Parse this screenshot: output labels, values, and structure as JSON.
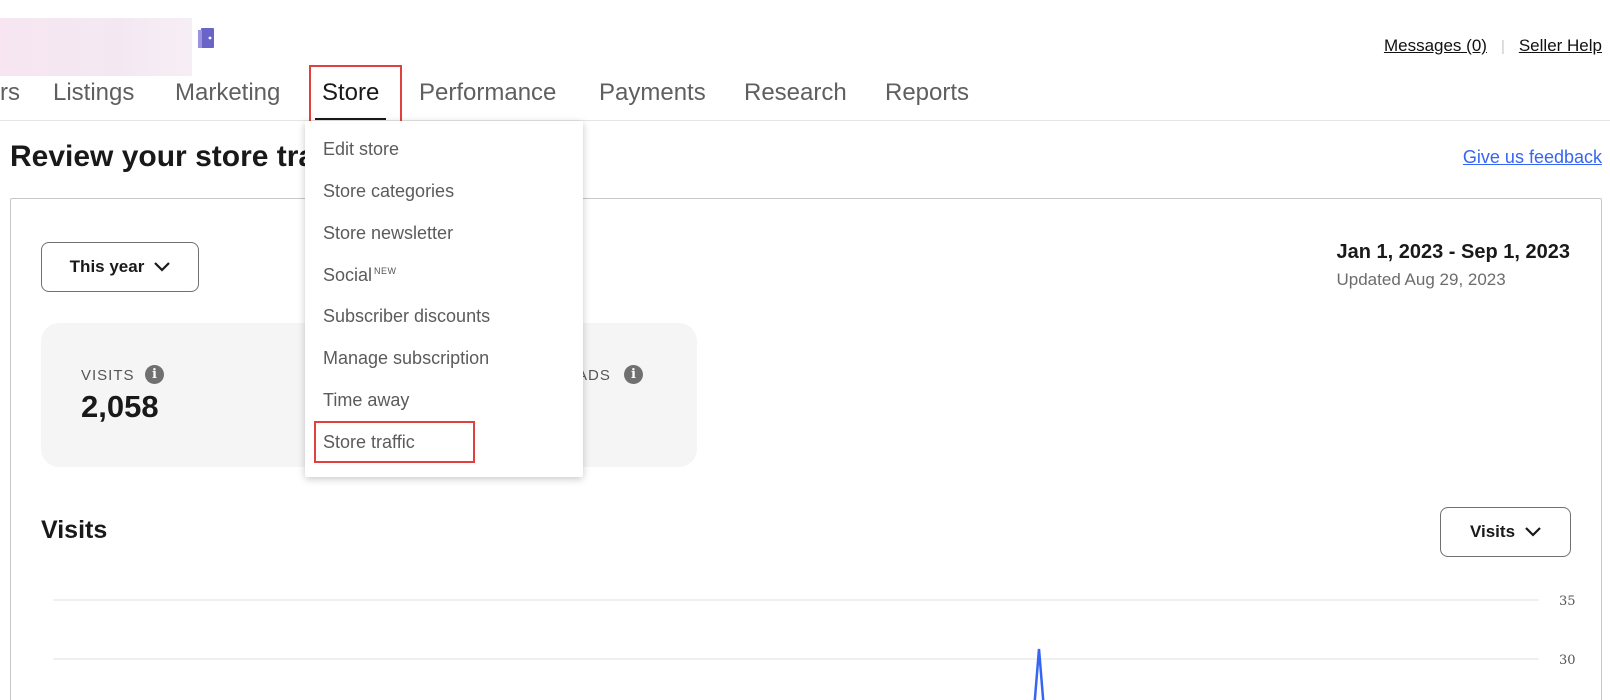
{
  "header": {
    "messages_label": "Messages (0)",
    "seller_help_label": "Seller Help"
  },
  "nav": {
    "tabs": [
      {
        "label": "rs"
      },
      {
        "label": "Listings"
      },
      {
        "label": "Marketing"
      },
      {
        "label": "Store"
      },
      {
        "label": "Performance"
      },
      {
        "label": "Payments"
      },
      {
        "label": "Research"
      },
      {
        "label": "Reports"
      }
    ],
    "active": "Store"
  },
  "page": {
    "title": "Review your store traffic",
    "feedback_label": "Give us feedback"
  },
  "filters": {
    "period_label": "This year",
    "date_range": "Jan 1, 2023 - Sep 1, 2023",
    "updated_text": "Updated Aug 29, 2023"
  },
  "metrics": {
    "visits_label": "VISITS",
    "visits_value": "2,058",
    "partial_label": "ADS"
  },
  "chart_section": {
    "title": "Visits",
    "metric_selector_label": "Visits"
  },
  "chart_data": {
    "type": "line",
    "title": "",
    "xlabel": "",
    "ylabel": "",
    "y_ticks": [
      35,
      30
    ],
    "ylim": [
      0,
      35
    ],
    "series": [
      {
        "values": [
          30
        ],
        "color": "#3665f3"
      }
    ],
    "grid": true
  },
  "store_menu": {
    "items": [
      {
        "label": "Edit store"
      },
      {
        "label": "Store categories"
      },
      {
        "label": "Store newsletter"
      },
      {
        "label": "Social",
        "badge": "NEW"
      },
      {
        "label": "Subscriber discounts"
      },
      {
        "label": "Manage subscription"
      },
      {
        "label": "Time away"
      },
      {
        "label": "Store traffic"
      }
    ]
  },
  "colors": {
    "accent_link": "#3665f3",
    "highlight_box": "#e0413f",
    "line_series": "#3665f3"
  },
  "icons": [
    "store-door-icon",
    "info-icon",
    "chevron-down-icon"
  ]
}
